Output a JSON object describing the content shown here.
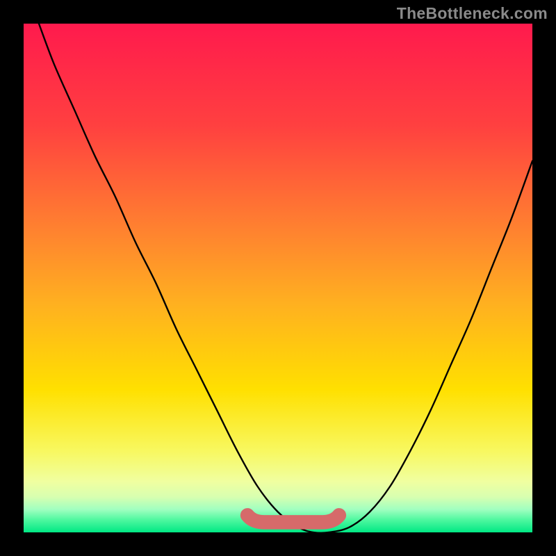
{
  "watermark": "TheBottleneck.com",
  "colors": {
    "frame": "#000000",
    "gradient_stops": [
      {
        "offset": 0.0,
        "color": "#ff1a4d"
      },
      {
        "offset": 0.2,
        "color": "#ff4040"
      },
      {
        "offset": 0.4,
        "color": "#ff8030"
      },
      {
        "offset": 0.55,
        "color": "#ffb020"
      },
      {
        "offset": 0.72,
        "color": "#ffe000"
      },
      {
        "offset": 0.84,
        "color": "#f8f860"
      },
      {
        "offset": 0.9,
        "color": "#f0ffa0"
      },
      {
        "offset": 0.93,
        "color": "#d8ffb0"
      },
      {
        "offset": 0.955,
        "color": "#a0ffc0"
      },
      {
        "offset": 0.975,
        "color": "#50f8a0"
      },
      {
        "offset": 1.0,
        "color": "#00e884"
      }
    ],
    "curve": "#000000",
    "accent_band": "#d66a6a"
  },
  "chart_data": {
    "type": "line",
    "title": "",
    "xlabel": "",
    "ylabel": "",
    "xlim": [
      0,
      100
    ],
    "ylim": [
      0,
      100
    ],
    "series": [
      {
        "name": "bottleneck-curve",
        "x": [
          3,
          6,
          10,
          14,
          18,
          22,
          26,
          30,
          34,
          38,
          42,
          46,
          50,
          54,
          57,
          60,
          64,
          68,
          72,
          76,
          80,
          84,
          88,
          92,
          96,
          100
        ],
        "values": [
          100,
          92,
          83,
          74,
          66,
          57,
          49,
          40,
          32,
          24,
          16,
          9,
          4,
          1,
          0,
          0,
          1,
          4,
          9,
          16,
          24,
          33,
          42,
          52,
          62,
          73
        ]
      }
    ],
    "accent_band": {
      "comment": "flat pink-coral segment near the trough of the curve",
      "x_start": 44,
      "x_end": 62,
      "y": 2,
      "thickness": 2.8,
      "endpoints": "round"
    }
  }
}
